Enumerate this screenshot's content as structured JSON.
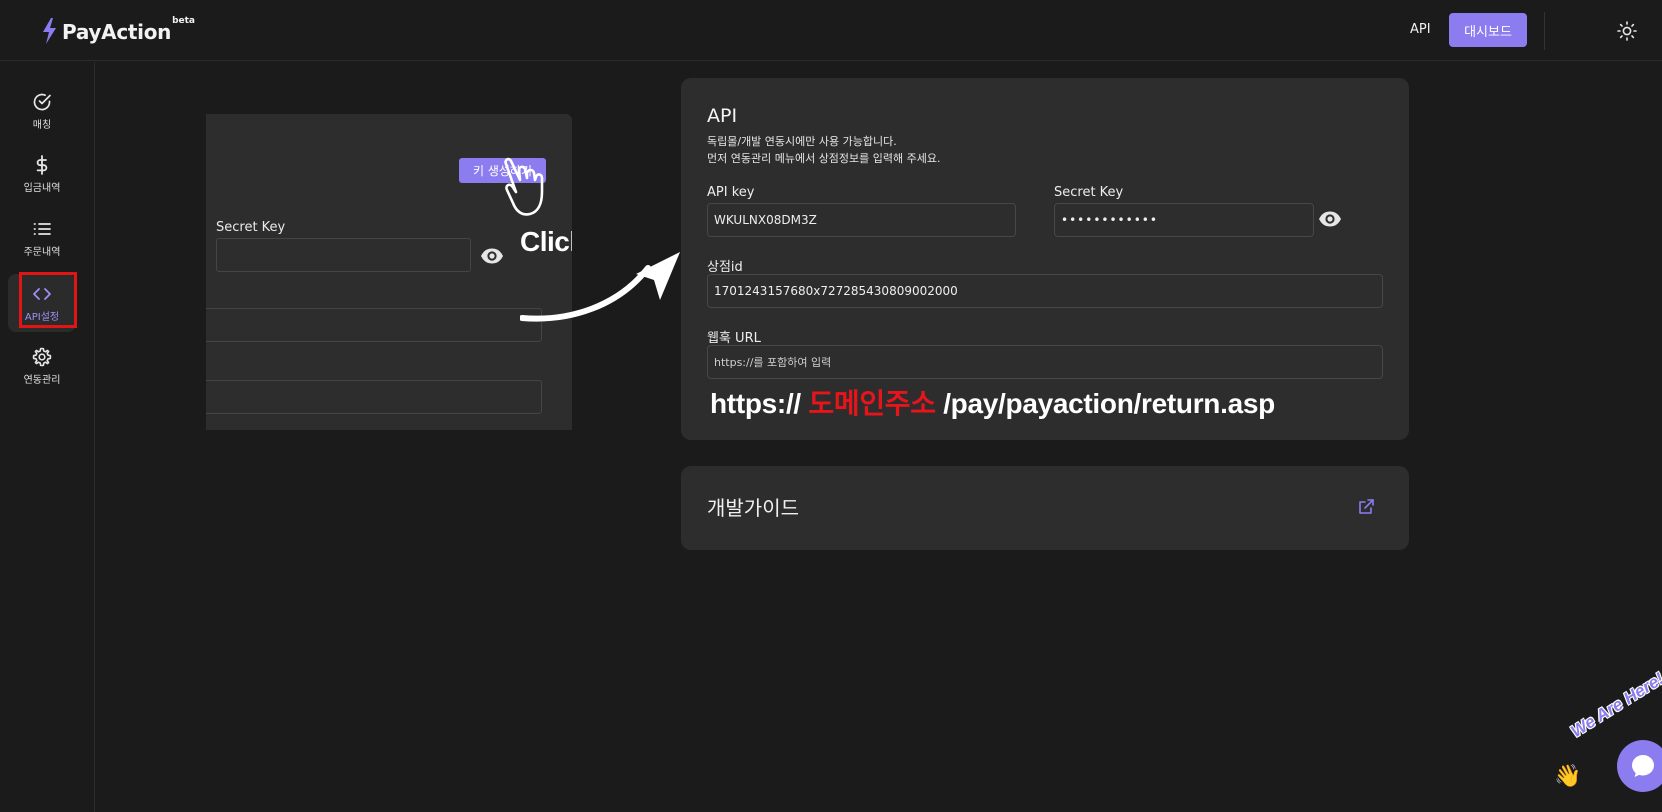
{
  "header": {
    "logo_text": "PayAction",
    "logo_badge": "beta",
    "nav_api": "API",
    "dashboard_button": "대시보드"
  },
  "sidebar": {
    "items": [
      {
        "label": "매칭",
        "icon": "check-circle-icon"
      },
      {
        "label": "입금내역",
        "icon": "dollar-icon"
      },
      {
        "label": "주문내역",
        "icon": "list-icon"
      },
      {
        "label": "API설정",
        "icon": "code-icon",
        "active": true
      },
      {
        "label": "연동관리",
        "icon": "gear-icon"
      }
    ]
  },
  "preview": {
    "generate_key_button": "키 생성하기",
    "secret_key_label": "Secret Key",
    "click_annotation": "Click!"
  },
  "api_card": {
    "title": "API",
    "desc_line1": "독립몰/개발 연동시에만 사용 가능합니다.",
    "desc_line2": "먼저 연동관리 메뉴에서 상점정보를 입력해 주세요.",
    "api_key_label": "API key",
    "api_key_value": "WKULNX08DM3Z",
    "secret_key_label": "Secret Key",
    "secret_key_value": "••••••••••••",
    "store_id_label": "상점id",
    "store_id_value": "1701243157680x727285430809002000",
    "webhook_label": "웹훅 URL",
    "webhook_placeholder": "https://를 포함하여 입력",
    "url_prefix": "https://",
    "url_domain": "도메인주소",
    "url_suffix": "/pay/payaction/return.asp"
  },
  "guide_card": {
    "title": "개발가이드"
  },
  "chat": {
    "label": "We Are Here!",
    "wave_emoji": "👋"
  },
  "colors": {
    "accent": "#8b7cf0",
    "background": "#1b1b1b",
    "card": "#2d2d2d",
    "highlight_red": "#e8141c"
  }
}
